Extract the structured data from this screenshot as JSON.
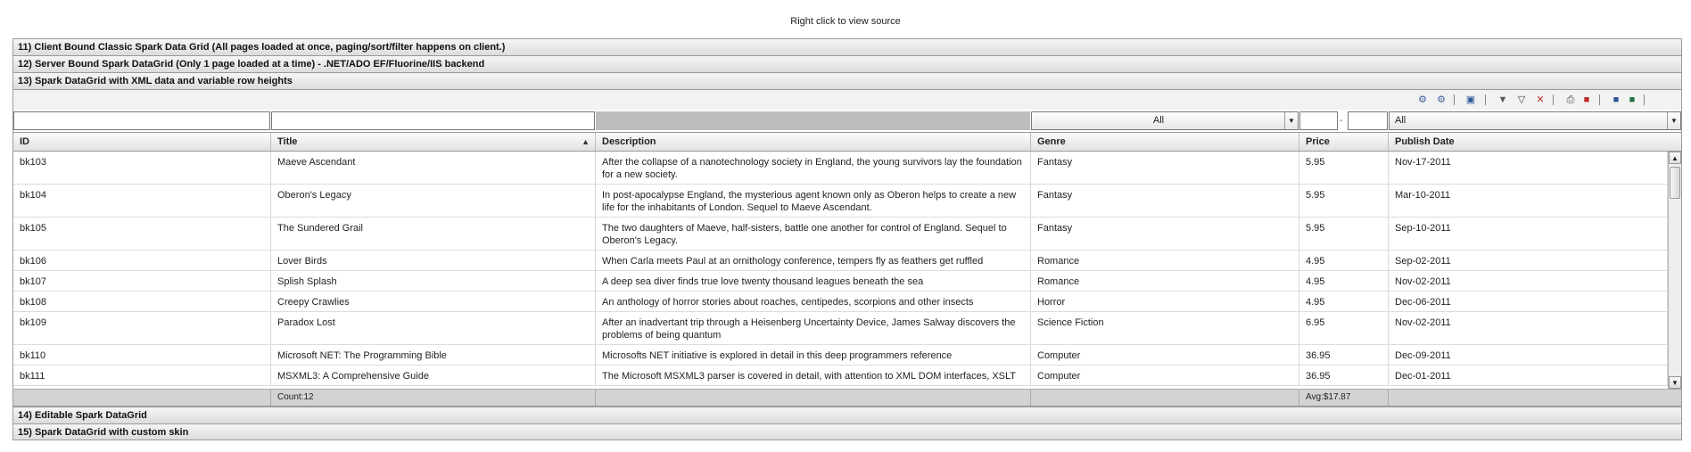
{
  "page": {
    "note": "Right click to view source"
  },
  "accordion": {
    "items": [
      "11) Client Bound Classic Spark Data Grid (All pages loaded at once, paging/sort/filter happens on client.)",
      "12) Server Bound Spark DataGrid (Only 1 page loaded at a time) - .NET/ADO EF/Fluorine/IIS backend",
      "13) Spark DataGrid with XML data and variable row heights"
    ],
    "after": [
      "14) Editable Spark DataGrid",
      "15) Spark DataGrid with custom skin"
    ]
  },
  "toolbar": {
    "icons": [
      "settings-icon",
      "save-settings-icon",
      "print-preview-icon",
      "filter-icon",
      "run-filter-icon",
      "clear-filter-icon",
      "print-icon",
      "pdf-icon",
      "word-icon",
      "excel-icon"
    ]
  },
  "filters": {
    "genre_selected": "All",
    "price_separator": "-",
    "date_selected": "All"
  },
  "grid": {
    "columns": [
      "ID",
      "Title",
      "Description",
      "Genre",
      "Price",
      "Publish Date"
    ],
    "sort": {
      "column": "Title",
      "direction": "ascending"
    },
    "rows": [
      {
        "id": "bk103",
        "title": "Maeve Ascendant",
        "description": "After the collapse of a nanotechnology society in England, the young survivors lay the foundation for a new society.",
        "genre": "Fantasy",
        "price": "5.95",
        "date": "Nov-17-2011"
      },
      {
        "id": "bk104",
        "title": "Oberon's Legacy",
        "description": "In post-apocalypse England, the mysterious agent known only as Oberon helps to create a new life for the inhabitants of London. Sequel to Maeve Ascendant.",
        "genre": "Fantasy",
        "price": "5.95",
        "date": "Mar-10-2011"
      },
      {
        "id": "bk105",
        "title": "The Sundered Grail",
        "description": "The two daughters of Maeve, half-sisters, battle one another for control of England. Sequel to Oberon's Legacy.",
        "genre": "Fantasy",
        "price": "5.95",
        "date": "Sep-10-2011"
      },
      {
        "id": "bk106",
        "title": "Lover Birds",
        "description": "When Carla meets Paul at an ornithology conference, tempers fly as feathers get ruffled",
        "genre": "Romance",
        "price": "4.95",
        "date": "Sep-02-2011"
      },
      {
        "id": "bk107",
        "title": "Splish Splash",
        "description": "A deep sea diver finds true love twenty thousand leagues beneath the sea",
        "genre": "Romance",
        "price": "4.95",
        "date": "Nov-02-2011"
      },
      {
        "id": "bk108",
        "title": "Creepy Crawlies",
        "description": "An anthology of horror stories about roaches, centipedes, scorpions  and other insects",
        "genre": "Horror",
        "price": "4.95",
        "date": "Dec-06-2011"
      },
      {
        "id": "bk109",
        "title": "Paradox Lost",
        "description": "After an inadvertant trip through a Heisenberg Uncertainty Device, James Salway discovers the problems of being quantum",
        "genre": "Science Fiction",
        "price": "6.95",
        "date": "Nov-02-2011"
      },
      {
        "id": "bk110",
        "title": "Microsoft NET: The Programming Bible",
        "description": "Microsofts NET initiative is explored in detail in this deep programmers reference",
        "genre": "Computer",
        "price": "36.95",
        "date": "Dec-09-2011"
      },
      {
        "id": "bk111",
        "title": "MSXML3: A Comprehensive Guide",
        "description": "The Microsoft MSXML3 parser is covered in detail, with attention to XML DOM interfaces, XSLT",
        "genre": "Computer",
        "price": "36.95",
        "date": "Dec-01-2011"
      }
    ],
    "footer": {
      "count": "Count:12",
      "avg": "Avg:$17.87"
    }
  }
}
